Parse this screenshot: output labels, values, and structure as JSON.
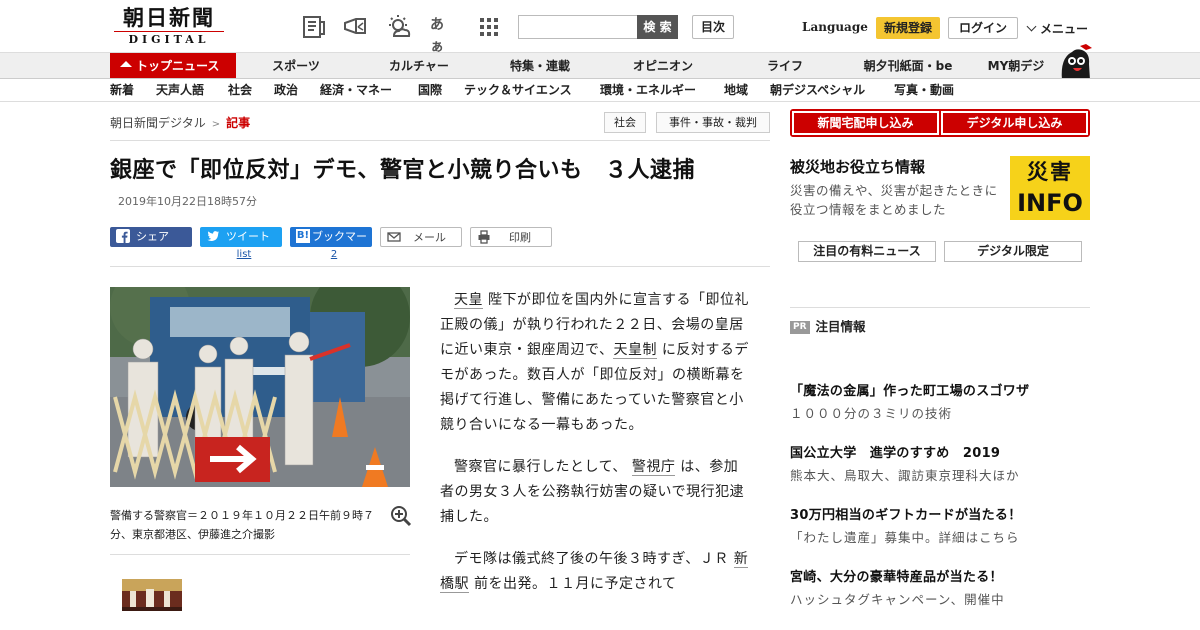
{
  "header": {
    "logo_main": "朝日新聞",
    "logo_sub": "DIGITAL",
    "search_button": "検 索",
    "search_placeholder": "",
    "toc_button": "目次",
    "language": "Language",
    "register": "新規登録",
    "login": "ログイン",
    "menu": "メニュー",
    "icons": [
      "newspaper-icon",
      "megaphone-icon",
      "weather-icon",
      "font-size-icon",
      "grid-apps-icon"
    ],
    "font_size_glyph": "あぁ"
  },
  "nav_primary": {
    "top_news": "トップニュース",
    "items": [
      "スポーツ",
      "カルチャー",
      "特集・連載",
      "オピニオン",
      "ライフ",
      "朝夕刊紙面・be",
      "MY朝デジ"
    ]
  },
  "nav_secondary": {
    "items": [
      "新着",
      "天声人語",
      "社会",
      "政治",
      "経済・マネー",
      "国際",
      "テック＆サイエンス",
      "環境・エネルギー",
      "地域",
      "朝デジスペシャル",
      "写真・動画"
    ]
  },
  "breadcrumb": {
    "home": "朝日新聞デジタル",
    "separator": ">",
    "current": "記事"
  },
  "tags": [
    "社会",
    "事件・事故・裁判"
  ],
  "article": {
    "headline": "銀座で「即位反対」デモ、警官と小競り合いも　３人逮捕",
    "date": "2019年10月22日18時57分",
    "share": {
      "facebook": "シェア",
      "twitter": "ツイート",
      "twitter_count": "list",
      "hatena": "ブックマーク",
      "hatena_count": "2",
      "mail": "メール",
      "print": "印刷"
    },
    "photo_caption": "警備する警察官＝２０１９年１０月２２日午前９時７分、東京都港区、伊藤進之介撮影",
    "paragraphs": [
      {
        "pre": "",
        "link1": "天皇",
        "mid": " 陛下が即位を国内外に宣言する「即位礼正殿の儀」が執り行われた２２日、会場の皇居に近い東京・銀座周辺で、",
        "link2": "天皇制",
        "post": " に反対するデモがあった。数百人が「即位反対」の横断幕を掲げて行進し、警備にあたっていた警察官と小競り合いになる一幕もあった。"
      },
      {
        "pre": "警察官に暴行したとして、 ",
        "link1": "警視庁",
        "mid": " は、参加者の男女３人を公務執行妨害の疑いで現行犯逮捕した。",
        "link2": "",
        "post": ""
      },
      {
        "pre": "デモ隊は儀式終了後の午後３時すぎ、ＪＲ ",
        "link1": "新橋駅",
        "mid": " 前を出発。１１月に予定されて",
        "link2": "",
        "post": ""
      }
    ]
  },
  "sidebar": {
    "subscribe_paper": "新聞宅配申し込み",
    "subscribe_digital": "デジタル申し込み",
    "disaster_title": "被災地お役立ち情報",
    "disaster_desc": "災害の備えや、災害が起きたときに役立つ情報をまとめました",
    "disaster_logo_top": "災害",
    "disaster_logo_bottom": "INFO",
    "tab_paid": "注目の有料ニュース",
    "tab_digital": "デジタル限定",
    "pr_badge": "PR",
    "pr_heading": "注目情報",
    "pr_items": [
      {
        "title": "「魔法の金属」作った町工場のスゴワザ",
        "sub": "１０００分の３ミリの技術"
      },
      {
        "title": "国公立大学　進学のすすめ　2019",
        "sub": "熊本大、鳥取大、諏訪東京理科大ほか"
      },
      {
        "title": "30万円相当のギフトカードが当たる！",
        "sub": "「わたし遺産」募集中。詳細はこちら"
      },
      {
        "title": "宮崎、大分の豪華特産品が当たる！",
        "sub": "ハッシュタグキャンペーン、開催中"
      }
    ]
  },
  "colors": {
    "brand_red": "#cc0000",
    "register_yellow": "#f4c531",
    "facebook": "#3b5998",
    "twitter": "#1da1f2",
    "hatena": "#1e74d4",
    "disaster_yellow": "#f6d21a"
  }
}
